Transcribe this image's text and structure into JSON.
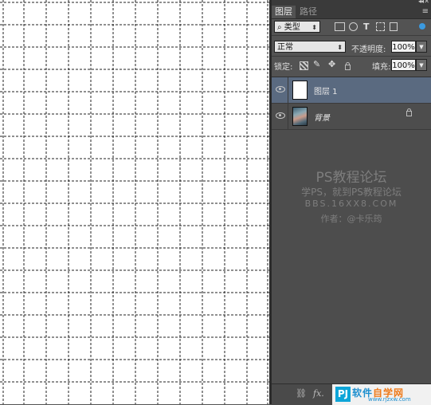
{
  "panel": {
    "tabs": [
      {
        "label": "图层",
        "active": true
      },
      {
        "label": "路径",
        "active": false
      }
    ],
    "filter": {
      "kind_label": "类型"
    },
    "blend": {
      "mode": "正常",
      "opacity_label": "不透明度:",
      "opacity_value": "100%"
    },
    "lock": {
      "label": "锁定:",
      "fill_label": "填充:",
      "fill_value": "100%"
    },
    "layers": [
      {
        "name": "图层 1",
        "selected": true,
        "locked": false
      },
      {
        "name": "背景",
        "selected": false,
        "locked": true
      }
    ],
    "watermark": {
      "line1": "PS教程论坛",
      "line2": "学PS，就到PS教程论坛",
      "line3": "BBS.16XX8.COM",
      "line4": "作者：@卡乐筠"
    },
    "footer_badge": {
      "logo_text": "PJ",
      "title_a": "软件",
      "title_b": "自学网",
      "url": "www.rjzxw.com"
    }
  },
  "canvas": {
    "grid": "dashed",
    "background": "#ffffff"
  },
  "colors": {
    "panel_bg": "#535353",
    "selected_layer": "#5a6a80"
  }
}
